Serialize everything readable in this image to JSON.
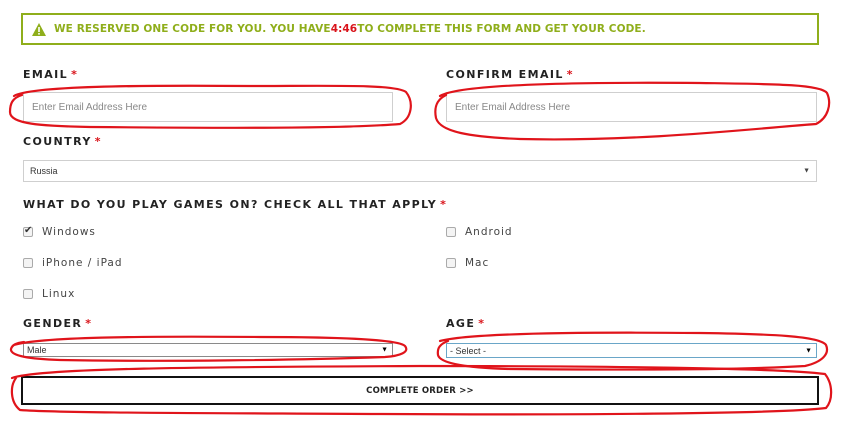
{
  "banner": {
    "text_before": "WE RESERVED ONE CODE FOR YOU. YOU HAVE ",
    "timer": "4:46",
    "text_after": " TO COMPLETE THIS FORM AND GET YOUR CODE.",
    "icon": "warning-icon",
    "color": "#8fae1b",
    "timer_color": "#d9141b"
  },
  "required_marker": "*",
  "email": {
    "label": "EMAIL",
    "placeholder": "Enter Email Address Here",
    "value": ""
  },
  "confirm_email": {
    "label": "CONFIRM EMAIL",
    "placeholder": "Enter Email Address Here",
    "value": ""
  },
  "country": {
    "label": "COUNTRY",
    "selected": "Russia",
    "arrow": "▼"
  },
  "platforms": {
    "label": "WHAT DO YOU PLAY GAMES ON? CHECK ALL THAT APPLY",
    "options": [
      {
        "label": "Windows",
        "checked": true
      },
      {
        "label": "Android",
        "checked": false
      },
      {
        "label": "iPhone / iPad",
        "checked": false
      },
      {
        "label": "Mac",
        "checked": false
      },
      {
        "label": "Linux",
        "checked": false
      }
    ]
  },
  "gender": {
    "label": "GENDER",
    "selected": "Male",
    "arrow": "▼"
  },
  "age": {
    "label": "AGE",
    "selected": "- Select -",
    "arrow": "▼"
  },
  "submit": {
    "label": "COMPLETE ORDER >>"
  },
  "annotation_color": "#e0141b"
}
